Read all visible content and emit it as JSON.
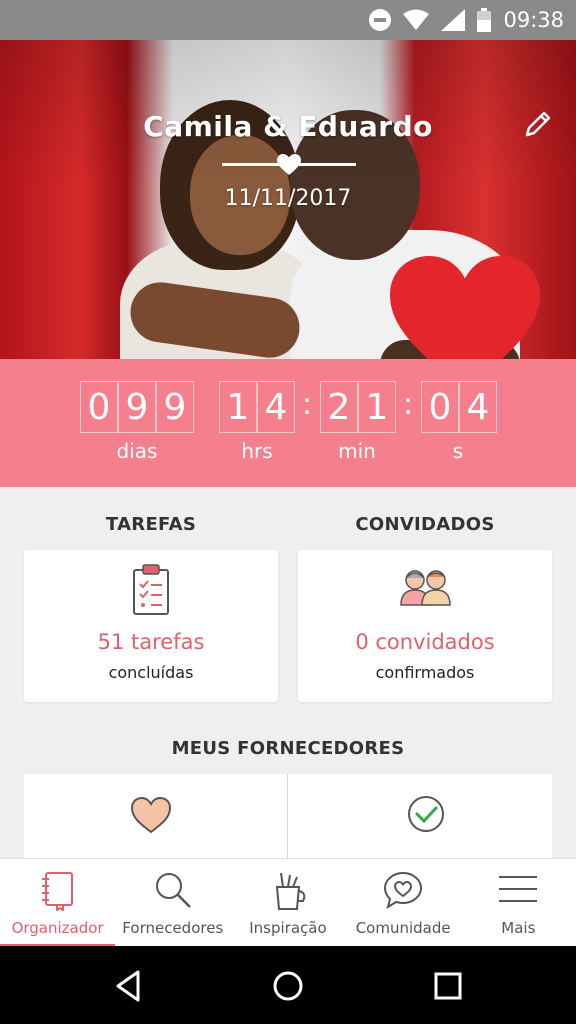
{
  "status_bar": {
    "time": "09:38"
  },
  "hero": {
    "title": "Camila & Eduardo",
    "date": "11/11/2017"
  },
  "countdown": {
    "days": [
      "0",
      "9",
      "9"
    ],
    "hours": [
      "1",
      "4"
    ],
    "minutes": [
      "2",
      "1"
    ],
    "seconds": [
      "0",
      "4"
    ],
    "labels": {
      "days": "dias",
      "hours": "hrs",
      "minutes": "min",
      "seconds": "s"
    }
  },
  "tasks": {
    "title": "TAREFAS",
    "count": "51 tarefas",
    "sub": "concluídas"
  },
  "guests": {
    "title": "CONVIDADOS",
    "count": "0 convidados",
    "sub": "confirmados"
  },
  "vendors": {
    "title": "MEUS FORNECEDORES"
  },
  "bottom_nav": {
    "items": [
      {
        "label": "Organizador",
        "icon": "notebook-icon",
        "active": true
      },
      {
        "label": "Fornecedores",
        "icon": "search-icon",
        "active": false
      },
      {
        "label": "Inspiração",
        "icon": "brushes-icon",
        "active": false
      },
      {
        "label": "Comunidade",
        "icon": "chat-heart-icon",
        "active": false
      },
      {
        "label": "Mais",
        "icon": "menu-icon",
        "active": false
      }
    ]
  },
  "colors": {
    "accent": "#f57f8c",
    "accent_text": "#e0606b"
  }
}
